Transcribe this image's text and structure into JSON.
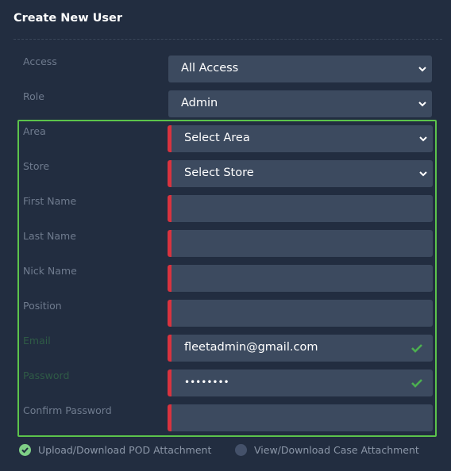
{
  "form": {
    "title": "Create New User",
    "fields": [
      {
        "label": "Access",
        "value": "All Access",
        "type": "select"
      },
      {
        "label": "Role",
        "value": "Admin",
        "type": "select"
      },
      {
        "label": "Area",
        "value": "Select Area",
        "type": "select"
      },
      {
        "label": "Store",
        "value": "Select Store",
        "type": "select"
      },
      {
        "label": "First Name",
        "value": "",
        "type": "text"
      },
      {
        "label": "Last Name",
        "value": "",
        "type": "text"
      },
      {
        "label": "Nick Name",
        "value": "",
        "type": "text"
      },
      {
        "label": "Position",
        "value": "",
        "type": "text"
      },
      {
        "label": "Email",
        "value": "fleetadmin@gmail.com",
        "type": "text"
      },
      {
        "label": "Password",
        "value": "••••••••",
        "type": "password"
      },
      {
        "label": "Confirm Password",
        "value": "",
        "type": "password"
      }
    ]
  },
  "options": [
    {
      "label": "Upload/Download POD Attachment",
      "checked": true
    },
    {
      "label": "View/Download Case Attachment",
      "checked": false
    }
  ],
  "colors": {
    "background": "#222d40",
    "field": "#3c4a5f",
    "required": "#d9333f",
    "highlight_border": "#5cc34b",
    "valid_check": "#4caf50"
  },
  "icons": {
    "select": "chevron-down-icon",
    "valid": "check-icon",
    "option_on": "check-circle-icon",
    "option_off": "empty-circle-icon"
  }
}
